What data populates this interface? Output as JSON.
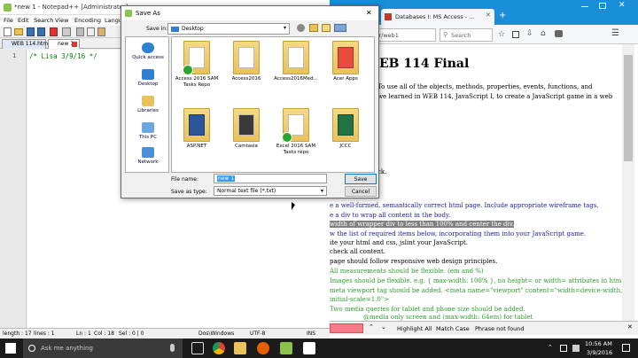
{
  "notepad": {
    "title": "*new 1 - Notepad++ [Administrator]",
    "menu": [
      "File",
      "Edit",
      "Search",
      "View",
      "Encoding",
      "Langu"
    ],
    "tabs": [
      "WEB 114.html",
      "new 1"
    ],
    "line_number": "1",
    "code_line": "/* Lisa 3/9/16 */",
    "status": {
      "length": "length : 17",
      "lines": "lines : 1",
      "ln": "Ln : 1",
      "col": "Col : 18",
      "sel": "Sel : 0 | 0",
      "eol": "Dos\\Windows",
      "encoding": "UTF-8",
      "ins": "INS"
    }
  },
  "firefox": {
    "tab_title": "Databases I: MS Access - ...",
    "url": "/fr/web1",
    "search_placeholder": "Search",
    "heading": "EB 114 Final",
    "para1": "To use all of the objects, methods, properties, events, functions, and",
    "para2": "we learned in WEB 114, JavaScript I, to create a JavaScript game in a web",
    "ck": "ck.",
    "lines": [
      "e a well-formed, semantically correct html page. Include appropriate wireframe tags.",
      "e a div to wrap all content in the body.",
      "width of wrapper div to less than 100% and center the div.",
      "w the list of required items below, incorporating them into your JavaScript game.",
      "ite your html and css, jslint your JavaScript.",
      "check all content.",
      "page should follow responsive web design principles."
    ],
    "green_lines": [
      "All measurements should be flexible. (em and %)",
      "Images should be flexible. e.g. { max-width: 100% }, no height= or width= attributes in html.",
      "meta viewport tag should be added. <meta name=\"viewport\" content=\"width=device-width,",
      "initial-scale=1.0\">",
      "Two media queries for tablet and phone size should be added.",
      "@media only screen and (max-width: 64em) for tablet"
    ],
    "find": {
      "highlight_all": "Highlight All",
      "match_case": "Match Case",
      "status": "Phrase not found"
    }
  },
  "dialog": {
    "title": "Save As",
    "save_in_label": "Save in:",
    "save_in_value": "Desktop",
    "places": [
      "Quick access",
      "Desktop",
      "Libraries",
      "This PC",
      "Network"
    ],
    "files": [
      "Access 2016 SAM Tasks Repo",
      "Access2016",
      "Access2016Med...",
      "Acer Apps",
      "ASP.NET",
      "Camtasia",
      "Excel 2016 SAM Tasks repo",
      "JCCC"
    ],
    "file_name_label": "File name:",
    "file_name_value": "new 1",
    "save_type_label": "Save as type:",
    "save_type_value": "Normal text file (*.txt)",
    "save_button": "Save",
    "cancel_button": "Cancel"
  },
  "taskbar": {
    "search_placeholder": "Ask me anything",
    "time": "10:56 AM",
    "date": "3/9/2016"
  }
}
